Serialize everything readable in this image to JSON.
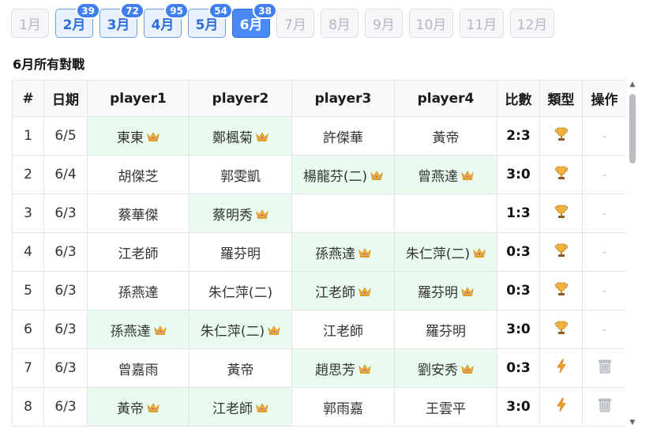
{
  "months": [
    {
      "label": "1月",
      "count": null,
      "state": "disabled"
    },
    {
      "label": "2月",
      "count": "39",
      "state": "has"
    },
    {
      "label": "3月",
      "count": "72",
      "state": "has"
    },
    {
      "label": "4月",
      "count": "95",
      "state": "has"
    },
    {
      "label": "5月",
      "count": "54",
      "state": "has"
    },
    {
      "label": "6月",
      "count": "38",
      "state": "active"
    },
    {
      "label": "7月",
      "count": null,
      "state": "disabled"
    },
    {
      "label": "8月",
      "count": null,
      "state": "disabled"
    },
    {
      "label": "9月",
      "count": null,
      "state": "disabled"
    },
    {
      "label": "10月",
      "count": null,
      "state": "disabled"
    },
    {
      "label": "11月",
      "count": null,
      "state": "disabled"
    },
    {
      "label": "12月",
      "count": null,
      "state": "disabled"
    }
  ],
  "section_title": "6月所有對戰",
  "table": {
    "headers": [
      "#",
      "日期",
      "player1",
      "player2",
      "player3",
      "player4",
      "比數",
      "類型",
      "操作"
    ],
    "rows": [
      {
        "no": "1",
        "date": "6/5",
        "players": [
          {
            "name": "東東",
            "win": true
          },
          {
            "name": "鄭楓菊",
            "win": true
          },
          {
            "name": "許傑華",
            "win": false
          },
          {
            "name": "黃帝",
            "win": false
          }
        ],
        "score": "2:3",
        "type": "trophy",
        "action": "-"
      },
      {
        "no": "2",
        "date": "6/4",
        "players": [
          {
            "name": "胡傑芝",
            "win": false
          },
          {
            "name": "郭雯凱",
            "win": false
          },
          {
            "name": "楊龍芬(二)",
            "win": true
          },
          {
            "name": "曾燕達",
            "win": true
          }
        ],
        "score": "3:0",
        "type": "trophy",
        "action": "-"
      },
      {
        "no": "3",
        "date": "6/3",
        "players": [
          {
            "name": "蔡華傑",
            "win": false
          },
          {
            "name": "蔡明秀",
            "win": true
          },
          {
            "name": "",
            "win": false
          },
          {
            "name": "",
            "win": false
          }
        ],
        "score": "1:3",
        "type": "trophy",
        "action": "-"
      },
      {
        "no": "4",
        "date": "6/3",
        "players": [
          {
            "name": "江老師",
            "win": false
          },
          {
            "name": "羅芬明",
            "win": false
          },
          {
            "name": "孫燕達",
            "win": true
          },
          {
            "name": "朱仁萍(二)",
            "win": true
          }
        ],
        "score": "0:3",
        "type": "trophy",
        "action": "-"
      },
      {
        "no": "5",
        "date": "6/3",
        "players": [
          {
            "name": "孫燕達",
            "win": false
          },
          {
            "name": "朱仁萍(二)",
            "win": false
          },
          {
            "name": "江老師",
            "win": true
          },
          {
            "name": "羅芬明",
            "win": true
          }
        ],
        "score": "0:3",
        "type": "trophy",
        "action": "-"
      },
      {
        "no": "6",
        "date": "6/3",
        "players": [
          {
            "name": "孫燕達",
            "win": true
          },
          {
            "name": "朱仁萍(二)",
            "win": true
          },
          {
            "name": "江老師",
            "win": false
          },
          {
            "name": "羅芬明",
            "win": false
          }
        ],
        "score": "3:0",
        "type": "trophy",
        "action": "-"
      },
      {
        "no": "7",
        "date": "6/3",
        "players": [
          {
            "name": "曾嘉雨",
            "win": false
          },
          {
            "name": "黃帝",
            "win": false
          },
          {
            "name": "趙思芳",
            "win": true
          },
          {
            "name": "劉安秀",
            "win": true
          }
        ],
        "score": "0:3",
        "type": "lightning",
        "action": "delete"
      },
      {
        "no": "8",
        "date": "6/3",
        "players": [
          {
            "name": "黃帝",
            "win": true
          },
          {
            "name": "江老師",
            "win": true
          },
          {
            "name": "郭雨嘉",
            "win": false
          },
          {
            "name": "王雲平",
            "win": false
          }
        ],
        "score": "3:0",
        "type": "lightning",
        "action": "delete"
      }
    ]
  },
  "colors": {
    "accent": "#4a8af4",
    "badge": "#3f7ff0",
    "win_cell": "#e9fbee",
    "border": "#e3e5e8"
  },
  "icons": {
    "crown": "crown-icon",
    "trophy": "trophy-icon",
    "lightning": "lightning-icon",
    "delete": "trash-icon"
  }
}
